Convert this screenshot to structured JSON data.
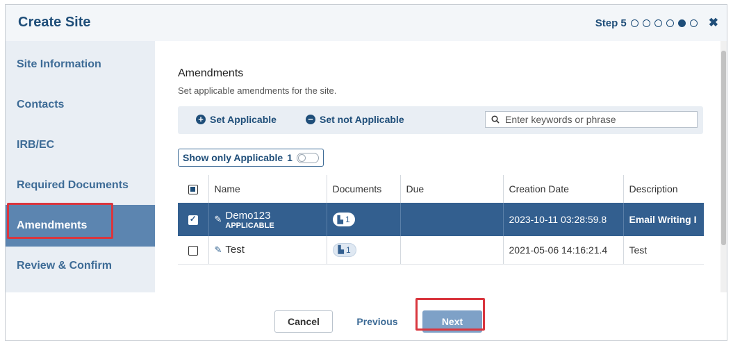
{
  "dialog": {
    "title": "Create Site",
    "step_label": "Step 5",
    "steps_total": 6,
    "current_step": 5,
    "close_icon": "close-icon"
  },
  "sidebar": {
    "items": [
      {
        "label": "Site Information",
        "active": false
      },
      {
        "label": "Contacts",
        "active": false
      },
      {
        "label": "IRB/EC",
        "active": false
      },
      {
        "label": "Required Documents",
        "active": false
      },
      {
        "label": "Amendments",
        "active": true
      },
      {
        "label": "Review & Confirm",
        "active": false
      }
    ]
  },
  "main": {
    "section_title": "Amendments",
    "section_subtitle": "Set applicable amendments for the site.",
    "toolbar": {
      "set_applicable": "Set Applicable",
      "set_not_applicable": "Set not Applicable",
      "search_placeholder": "Enter keywords or phrase"
    },
    "filter": {
      "label": "Show only Applicable",
      "count": "1",
      "toggle_on": false
    },
    "table": {
      "columns": [
        "Name",
        "Documents",
        "Due",
        "Creation Date",
        "Description"
      ],
      "rows": [
        {
          "name": "Demo123",
          "badge": "APPLICABLE",
          "documents": "1",
          "due": "",
          "creation_date": "2023-10-11 03:28:59.8",
          "description": "Email Writing I",
          "selected": true,
          "checked": true
        },
        {
          "name": "Test",
          "badge": "",
          "documents": "1",
          "due": "",
          "creation_date": "2021-05-06 14:16:21.4",
          "description": "Test",
          "selected": false,
          "checked": false
        }
      ]
    }
  },
  "footer": {
    "cancel_label": "Cancel",
    "previous_label": "Previous",
    "next_label": "Next"
  },
  "colors": {
    "accent": "#1f4e79",
    "selected_row": "#335f8f",
    "sidebar_active": "#5c85b0",
    "highlight_box": "#d9363e",
    "next_button": "#7ea1c7"
  }
}
